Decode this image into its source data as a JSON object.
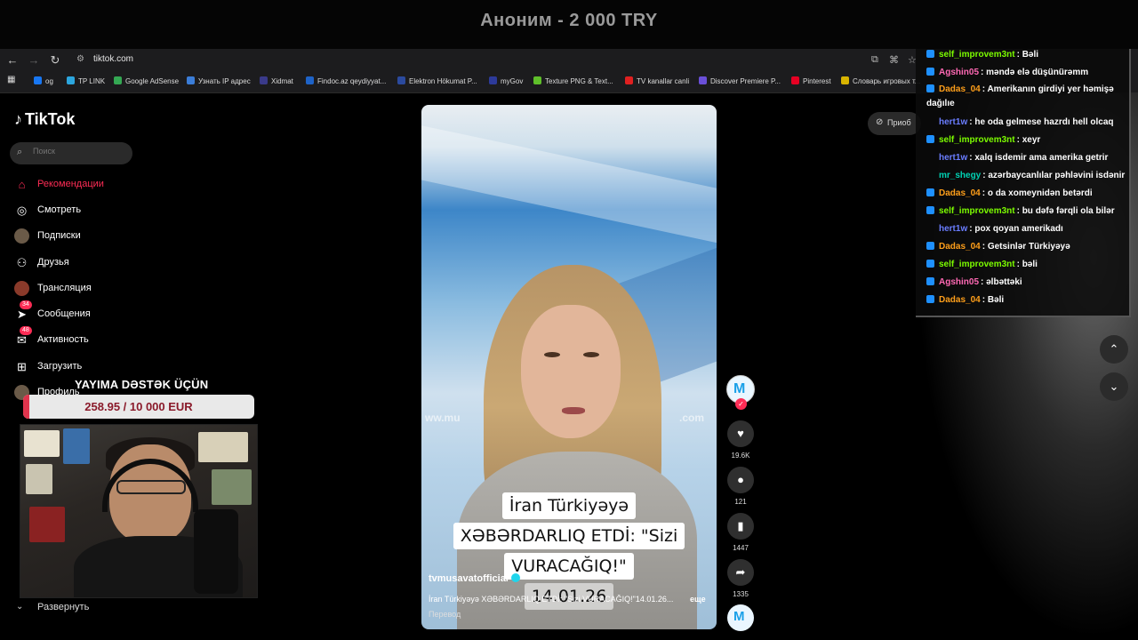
{
  "stream_banner": {
    "title": "Аноним - 2 000 TRY"
  },
  "browser": {
    "url": "tiktok.com",
    "bookmarks": [
      {
        "label": "og",
        "color": "#1877f2"
      },
      {
        "label": "TP LINK",
        "color": "#2ca6de"
      },
      {
        "label": "Google AdSense",
        "color": "#34a853"
      },
      {
        "label": "Узнать IP адрес",
        "color": "#3b7dd8"
      },
      {
        "label": "Xidmat",
        "color": "#3a3a8a"
      },
      {
        "label": "Findoc.az qeydiyyat...",
        "color": "#1e63c8"
      },
      {
        "label": "Elektron Hökumat P...",
        "color": "#2b4a9e"
      },
      {
        "label": "myGov",
        "color": "#2d3a9a"
      },
      {
        "label": "Texture PNG & Text...",
        "color": "#5fbf2a"
      },
      {
        "label": "TV kanallar canli",
        "color": "#e02020"
      },
      {
        "label": "Discover Premiere P...",
        "color": "#6a4fd8"
      },
      {
        "label": "Pinterest",
        "color": "#e60023"
      },
      {
        "label": "Словарь игровых т...",
        "color": "#d8b400"
      }
    ]
  },
  "tiktok": {
    "logo": "TikTok",
    "search_placeholder": "Поиск",
    "nav": [
      {
        "label": "Рекомендации",
        "icon": "home-icon",
        "active": true
      },
      {
        "label": "Смотреть",
        "icon": "compass-icon"
      },
      {
        "label": "Подписки",
        "icon": "avatar-icon"
      },
      {
        "label": "Друзья",
        "icon": "friends-icon"
      },
      {
        "label": "Трансляция",
        "icon": "live-avatar-icon"
      },
      {
        "label": "Сообщения",
        "icon": "send-icon",
        "badge": "34"
      },
      {
        "label": "Активность",
        "icon": "inbox-icon",
        "badge": "48"
      },
      {
        "label": "Загрузить",
        "icon": "plus-square-icon"
      },
      {
        "label": "Профиль",
        "icon": "profile-avatar-icon"
      }
    ],
    "expand_label": "Развернуть",
    "get_app_label": "Приоб"
  },
  "donation": {
    "title": "YAYIMA DƏSTƏK ÜÇÜN",
    "progress_text": "258.95 / 10 000 EUR",
    "progress_fraction": 0.0259
  },
  "video": {
    "caption_lines": [
      "İran Türkiyəyə",
      "XƏBƏRDARLIQ ETDİ: \"Sizi",
      "VURACAĞIQ!\"",
      "14.01.26"
    ],
    "author": "tvmusavatofficial",
    "description": "İran Türkiyəyə XƏBƏRDARLIQ ETDİ: \"Sizi VURACAĞIQ!\"14.01.26...",
    "more_label": "еще",
    "translate_label": "Перевод",
    "likes": "19.6K",
    "comments": "121",
    "saves": "1447",
    "shares": "1335"
  },
  "chat": [
    {
      "user": "self_improvem3nt",
      "msg": "Bəli",
      "color": "#7cfc00",
      "icon": true
    },
    {
      "user": "Agshin05",
      "msg": "məndə elə düşünürəmm",
      "color": "#ff69b4",
      "icon": true
    },
    {
      "user": "Dadas_04",
      "msg": "Amerikanın girdiyi yer həmişə dağılıe",
      "color": "#ff9f1a",
      "icon": true,
      "wrap": true
    },
    {
      "user": "hert1w",
      "msg": "he oda gelmese hazrdı hell olcaq",
      "color": "#6a7dff",
      "icon": false
    },
    {
      "user": "self_improvem3nt",
      "msg": "xeyr",
      "color": "#7cfc00",
      "icon": true
    },
    {
      "user": "hert1w",
      "msg": "xalq isdemir ama amerika getrir",
      "color": "#6a7dff",
      "icon": false
    },
    {
      "user": "mr_shegy",
      "msg": "azərbaycanlılar pəhləvini isdənir",
      "color": "#00d2b4",
      "icon": false
    },
    {
      "user": "Dadas_04",
      "msg": "o da xomeynidən betərdi",
      "color": "#ff9f1a",
      "icon": true
    },
    {
      "user": "self_improvem3nt",
      "msg": "bu dəfə fərqli ola bilər",
      "color": "#7cfc00",
      "icon": true
    },
    {
      "user": "hert1w",
      "msg": "pox qoyan amerikadı",
      "color": "#6a7dff",
      "icon": false
    },
    {
      "user": "Dadas_04",
      "msg": "Getsinlər Türkiyəyə",
      "color": "#ff9f1a",
      "icon": true
    },
    {
      "user": "self_improvem3nt",
      "msg": "bəli",
      "color": "#7cfc00",
      "icon": true
    },
    {
      "user": "Agshin05",
      "msg": "əlbəttəki",
      "color": "#ff69b4",
      "icon": true
    },
    {
      "user": "Dadas_04",
      "msg": "Bəli",
      "color": "#ff9f1a",
      "icon": true
    }
  ]
}
